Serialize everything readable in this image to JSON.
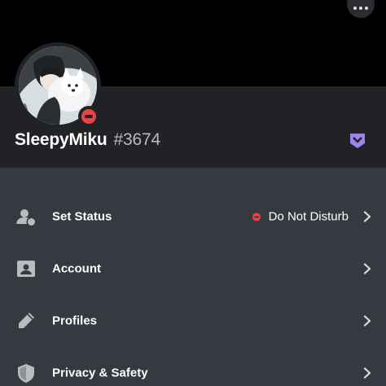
{
  "profile": {
    "username": "SleepyMiku",
    "discriminator": "#3674",
    "status": "dnd"
  },
  "menu": {
    "items": [
      {
        "label": "Set Status",
        "icon": "user-status-icon",
        "value": "Do Not Disturb"
      },
      {
        "label": "Account",
        "icon": "id-card-icon"
      },
      {
        "label": "Profiles",
        "icon": "pencil-icon"
      },
      {
        "label": "Privacy & Safety",
        "icon": "shield-icon"
      }
    ]
  },
  "colors": {
    "banner": "#000000",
    "header": "#202225",
    "menu_bg": "#36393f",
    "dnd": "#ed4245",
    "nitro_badge": "#9b84ec",
    "icon_gray": "#b9bbbe"
  },
  "icons": {
    "more": "more-dots-icon",
    "badge": "nitro-badge-icon",
    "chevron": "chevron-right-icon"
  }
}
